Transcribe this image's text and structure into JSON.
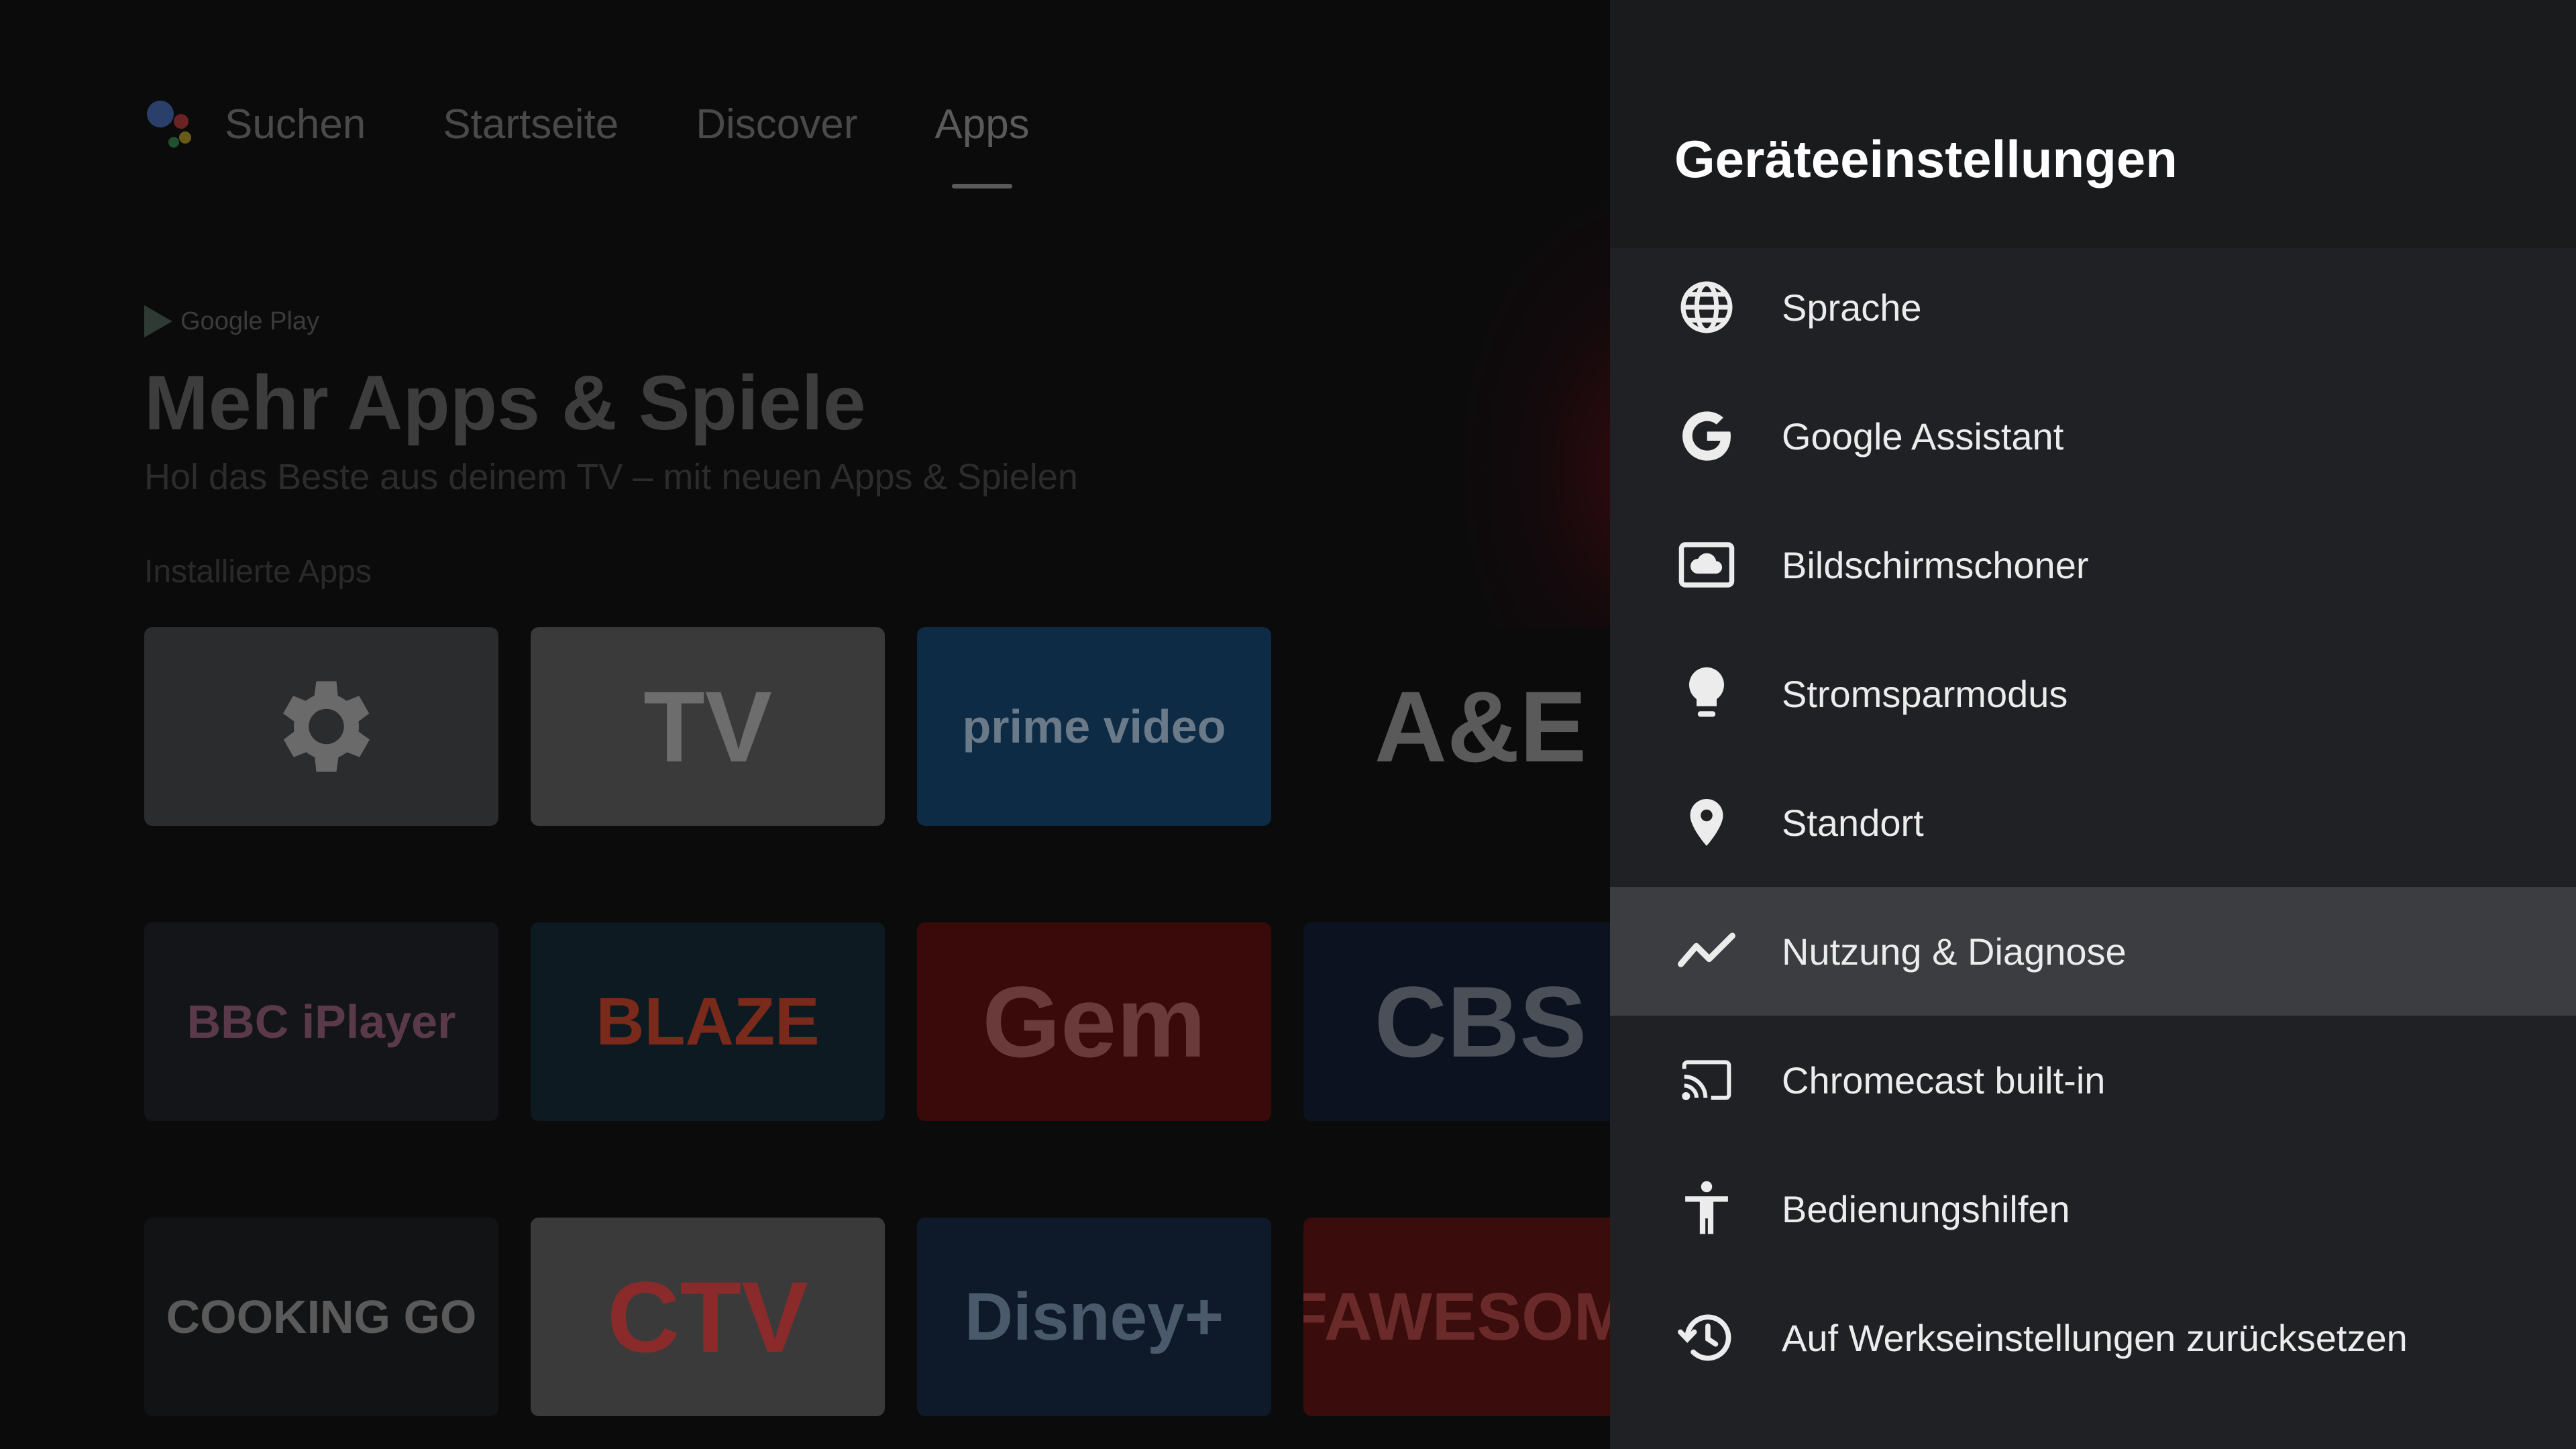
{
  "nav": {
    "tabs": [
      {
        "label": "Suchen"
      },
      {
        "label": "Startseite"
      },
      {
        "label": "Discover"
      },
      {
        "label": "Apps",
        "active": true
      }
    ]
  },
  "apps_page": {
    "store_label": "Google Play",
    "headline": "Mehr Apps & Spiele",
    "subline": "Hol das Beste aus deinem TV – mit neuen Apps & Spielen",
    "section_label": "Installierte Apps",
    "tiles": [
      {
        "name": "settings",
        "text": "",
        "bg": "#2a2c2e",
        "fg": "#6a6a6a"
      },
      {
        "name": "google-tv",
        "text": "TV",
        "bg": "#3a3a3a",
        "fg": "#6d6d6d"
      },
      {
        "name": "prime-video",
        "text": "prime video",
        "bg": "#0d2b45",
        "fg": "#6a7a89"
      },
      {
        "name": "a-and-e",
        "text": "A&E",
        "bg": "#0b0b0c",
        "fg": "#5a5a5a"
      },
      {
        "name": "bbc-iplayer",
        "text": "BBC iPlayer",
        "bg": "#141518",
        "fg": "#5a3a4a"
      },
      {
        "name": "blaze",
        "text": "BLAZE",
        "bg": "#0e1a22",
        "fg": "#7a2a1a"
      },
      {
        "name": "gem",
        "text": "Gem",
        "bg": "#3a0a0a",
        "fg": "#6a3a3a"
      },
      {
        "name": "cbs",
        "text": "CBS",
        "bg": "#0c1220",
        "fg": "#4a4f58"
      },
      {
        "name": "cooking-channel-go",
        "text": "COOKING GO",
        "bg": "#121314",
        "fg": "#5a5a5a"
      },
      {
        "name": "ctv",
        "text": "CTV",
        "bg": "#3a3a3a",
        "fg": "#8a2a2a"
      },
      {
        "name": "disney-plus",
        "text": "Disney+",
        "bg": "#0e1a2a",
        "fg": "#4a5a6a"
      },
      {
        "name": "fawesome",
        "text": "FAWESOME",
        "bg": "#3a0c0c",
        "fg": "#6a2a2a"
      }
    ]
  },
  "panel": {
    "title": "Geräteeinstellungen",
    "items": [
      {
        "label": "Sprache",
        "icon": "globe-icon"
      },
      {
        "label": "Google Assistant",
        "icon": "google-g-icon"
      },
      {
        "label": "Bildschirmschoner",
        "icon": "screensaver-icon"
      },
      {
        "label": "Stromsparmodus",
        "icon": "lightbulb-icon"
      },
      {
        "label": "Standort",
        "icon": "location-pin-icon"
      },
      {
        "label": "Nutzung & Diagnose",
        "icon": "trending-line-icon",
        "focused": true
      },
      {
        "label": "Chromecast built-in",
        "icon": "cast-icon"
      },
      {
        "label": "Bedienungshilfen",
        "icon": "accessibility-icon"
      },
      {
        "label": "Auf Werkseinstellungen zurücksetzen",
        "icon": "history-reset-icon"
      }
    ]
  },
  "colors": {
    "panel_bg": "#202124",
    "panel_header_bg": "#1a1b1d",
    "focused_row": "#3c3d40",
    "text": "#ececec"
  }
}
